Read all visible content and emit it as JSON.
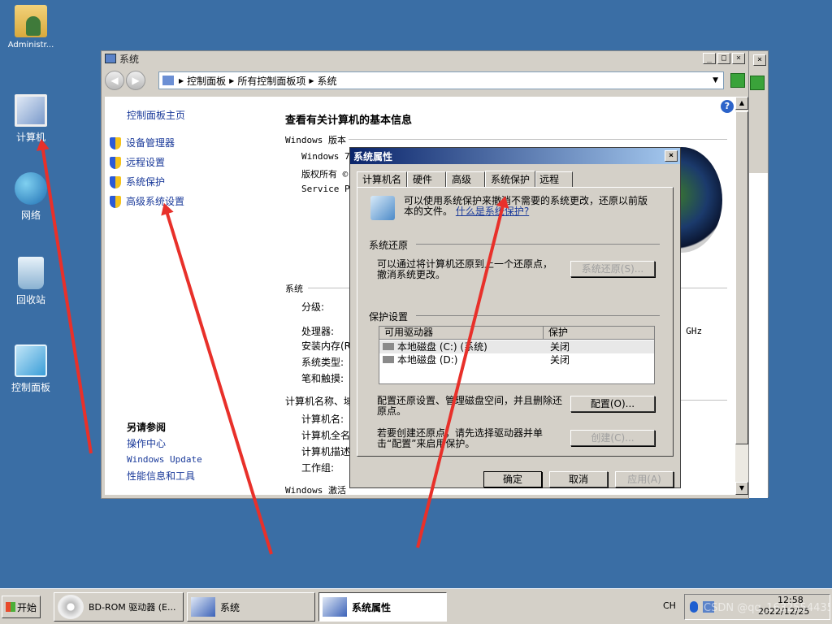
{
  "desktop": {
    "icons": [
      {
        "label": "Administr..."
      },
      {
        "label": "计算机"
      },
      {
        "label": "网络"
      },
      {
        "label": "回收站"
      },
      {
        "label": "控制面板"
      }
    ]
  },
  "main_window": {
    "title": "系统",
    "breadcrumb": [
      "控制面板",
      "所有控制面板项",
      "系统"
    ],
    "sidebar": {
      "home": "控制面板主页",
      "items": [
        "设备管理器",
        "远程设置",
        "系统保护",
        "高级系统设置"
      ],
      "see_also_title": "另请参阅",
      "see_also": [
        "操作中心",
        "Windows Update",
        "性能信息和工具"
      ]
    },
    "content": {
      "heading": "查看有关计算机的基本信息",
      "edition_title": "Windows 版本",
      "edition_rows": [
        "Windows 7",
        "版权所有 ©",
        "Service Pa"
      ],
      "system_title": "系统",
      "system_rows": [
        "分级:",
        "处理器:",
        "安装内存(R",
        "系统类型:",
        "笔和触摸:"
      ],
      "ghz": "0 GHz",
      "computer_title": "计算机名称、域",
      "computer_rows": [
        "计算机名:",
        "计算机全名",
        "计算机描述",
        "工作组:"
      ],
      "activation_title": "Windows 激活"
    }
  },
  "dialog": {
    "title": "系统属性",
    "tabs": [
      "计算机名",
      "硬件",
      "高级",
      "系统保护",
      "远程"
    ],
    "active_tab": "系统保护",
    "intro": "可以使用系统保护来撤消不需要的系统更改，还原以前版本的文件。",
    "intro_link": "什么是系统保护?",
    "restore_title": "系统还原",
    "restore_text": "可以通过将计算机还原到上一个还原点，撤消系统更改。",
    "restore_button": "系统还原(S)...",
    "protection_title": "保护设置",
    "table_headers": [
      "可用驱动器",
      "保护"
    ],
    "drives": [
      {
        "name": "本地磁盘 (C:) (系统)",
        "protection": "关闭"
      },
      {
        "name": "本地磁盘 (D:)",
        "protection": "关闭"
      }
    ],
    "config_text": "配置还原设置、管理磁盘空间，并且删除还原点。",
    "config_button": "配置(O)...",
    "create_text": "若要创建还原点，请先选择驱动器并单击“配置”来启用保护。",
    "create_button": "创建(C)...",
    "ok": "确定",
    "cancel": "取消",
    "apply": "应用(A)"
  },
  "taskbar": {
    "start": "开始",
    "tasks": [
      {
        "label": "BD-ROM 驱动器 (E..."
      },
      {
        "label": "系统"
      },
      {
        "label": "系统属性"
      }
    ],
    "ime": "CH",
    "time": "12:58",
    "date": "2022/12/25"
  },
  "watermark": "CSDN @qq_1632554435",
  "colors": {
    "desktop": "#3a6ea5",
    "arrow": "#e8302a",
    "link": "#1a3a9a"
  }
}
